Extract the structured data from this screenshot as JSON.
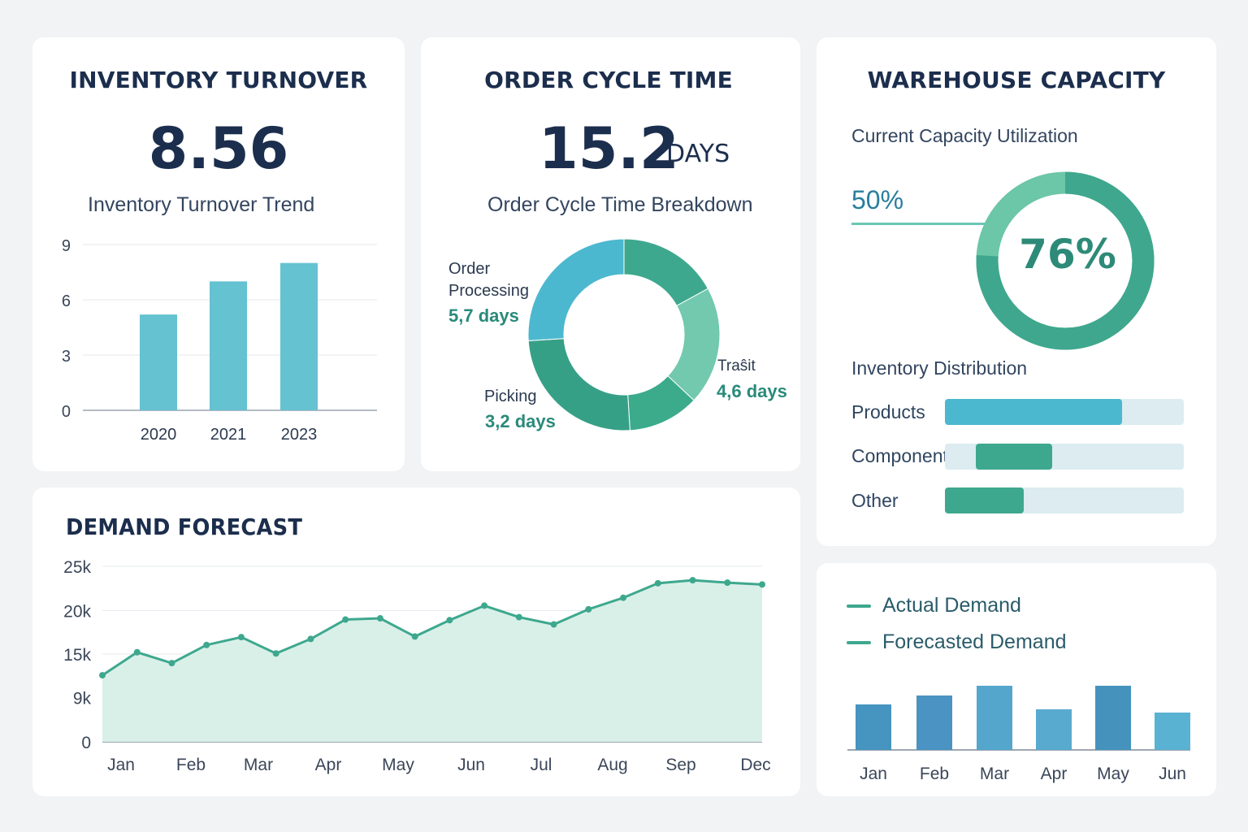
{
  "colors": {
    "teal_light": "#64c2d1",
    "teal": "#3ea88e",
    "teal_dark": "#2e9c82",
    "mint": "#72c9ae",
    "blue": "#4c92bd",
    "navy": "#1c2e4d",
    "track": "#dcecf0"
  },
  "inventory": {
    "title": "INVENTORY TURNOVER",
    "value": "8.56",
    "subtitle": "Inventory Turnover  Trend"
  },
  "order_cycle": {
    "title": "ORDER CYCLE TIME",
    "value": "15.2",
    "unit": "DAYS",
    "subtitle": "Order Cycle Time Breakdown",
    "labels": [
      {
        "name": "Order\nProcessing",
        "value": "5,7 days"
      },
      {
        "name": "Traŝit",
        "value": "4,6 days"
      },
      {
        "name": "Picking",
        "value": "3,2 days"
      }
    ]
  },
  "warehouse": {
    "title": "WAREHOUSE CAPACITY",
    "subtitle": "Current Capacity Utilization",
    "marker_label": "50%",
    "utilization_label": "76%",
    "utilization": 76,
    "distribution_title": "Inventory Distribution",
    "distribution": [
      {
        "label": "Products",
        "fraction": 0.74,
        "start": 0.0,
        "color": "#4cb8cf"
      },
      {
        "label": "Components",
        "fraction": 0.32,
        "start": 0.13,
        "color": "#3ea88e"
      },
      {
        "label": "Other",
        "fraction": 0.33,
        "start": 0.0,
        "color": "#3ea88e"
      }
    ]
  },
  "demand": {
    "title": "DEMAND FORECAST"
  },
  "legend": {
    "items": [
      {
        "label": "Actual Demand",
        "color": "#3ea88e"
      },
      {
        "label": "Forecasted Demand",
        "color": "#3ea88e"
      }
    ]
  },
  "chart_data": [
    {
      "type": "bar",
      "title": "Inventory Turnover  Trend",
      "categories": [
        "2020",
        "2021",
        "2023"
      ],
      "values": [
        5.2,
        7.0,
        8.0
      ],
      "ylim": [
        0,
        9
      ],
      "yticks": [
        "0",
        "3",
        "6",
        "9"
      ],
      "grid": true
    },
    {
      "type": "pie",
      "title": "Order Cycle Time Breakdown",
      "donut": true,
      "slices": [
        {
          "label": "segment-1",
          "value": 17
        },
        {
          "label": "segment-2",
          "value": 20
        },
        {
          "label": "segment-3",
          "value": 12
        },
        {
          "label": "segment-4",
          "value": 25
        },
        {
          "label": "segment-5",
          "value": 26
        }
      ],
      "colors": [
        "#3ea88e",
        "#72c9ae",
        "#3bab8c",
        "#36a087",
        "#4cb8cf"
      ]
    },
    {
      "type": "area",
      "title": "DEMAND FORECAST",
      "x": [
        "Jan",
        "",
        "Feb",
        "",
        "Mar",
        "",
        "Apr",
        "",
        "May",
        "",
        "",
        "Jun",
        "",
        "Jul",
        "",
        "Aug",
        "",
        "Sep",
        "",
        "",
        "Dec"
      ],
      "xticks": [
        "Jan",
        "Feb",
        "Mar",
        "Apr",
        "May",
        "Jun",
        "Jul",
        "Aug",
        "Sep",
        "Dec"
      ],
      "values": [
        11,
        14.8,
        13,
        16,
        17.3,
        14.6,
        17,
        20.2,
        20.4,
        17.4,
        20.1,
        22.5,
        20.6,
        19.4,
        21.9,
        23.8,
        26.2,
        26.7,
        26.3,
        26
      ],
      "ylim": [
        0,
        29
      ],
      "yticks": [
        "0",
        "9k",
        "15k",
        "20k",
        "25k"
      ],
      "grid": true
    },
    {
      "type": "bar",
      "categories": [
        "Jan",
        "Feb",
        "Mar",
        "Apr",
        "May",
        "Jun"
      ],
      "values": [
        56,
        67,
        79,
        50,
        79,
        46
      ],
      "ylim": [
        0,
        100
      ],
      "colors": [
        "#4694c0",
        "#4a93c2",
        "#54a6cc",
        "#58aacf",
        "#4593bd",
        "#5ab2d2"
      ]
    }
  ]
}
